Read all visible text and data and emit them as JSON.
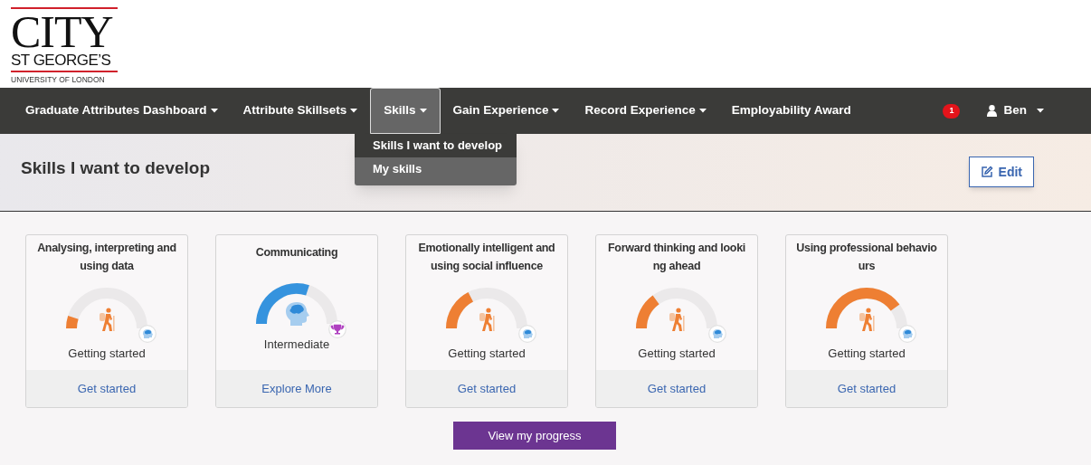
{
  "logo": {
    "lines": [
      "CITY",
      "ST GEORGE’S",
      "UNIVERSITY OF LONDON"
    ]
  },
  "nav": {
    "items": [
      {
        "label": "Graduate Attributes Dashboard",
        "dropdown": true,
        "selected": false
      },
      {
        "label": "Attribute Skillsets",
        "dropdown": true,
        "selected": false
      },
      {
        "label": "Skills",
        "dropdown": true,
        "selected": true
      },
      {
        "label": "Gain Experience",
        "dropdown": true,
        "selected": false
      },
      {
        "label": "Record Experience",
        "dropdown": true,
        "selected": false
      },
      {
        "label": "Employability Award",
        "dropdown": false,
        "selected": false
      }
    ],
    "notification_count": "1",
    "user": "Ben"
  },
  "menu": {
    "items": [
      {
        "label": "Skills I want to develop",
        "selected": true
      },
      {
        "label": "My skills",
        "selected": false
      }
    ]
  },
  "page": {
    "title": "Skills I want to develop",
    "edit_button": "Edit"
  },
  "cards": [
    {
      "title_lines": [
        "Analysing, interpreting and",
        "using data"
      ],
      "kind": "beginner",
      "status": "Getting started",
      "link": "Get started"
    },
    {
      "title_lines": [
        "Communicating"
      ],
      "kind": "intermediate",
      "status": "Intermediate",
      "link": "Explore More"
    },
    {
      "title_lines": [
        "Emotionally intelligent and",
        "using social influence"
      ],
      "kind": "beginner",
      "status": "Getting started",
      "link": "Get started"
    },
    {
      "title_lines": [
        "Forward thinking and looki",
        "ng ahead"
      ],
      "kind": "beginner",
      "status": "Getting started",
      "link": "Get started"
    },
    {
      "title_lines": [
        "Using professional behavio",
        "urs"
      ],
      "kind": "beginner",
      "status": "Getting started",
      "link": "Get started"
    }
  ],
  "progress_button": "View my progress"
}
